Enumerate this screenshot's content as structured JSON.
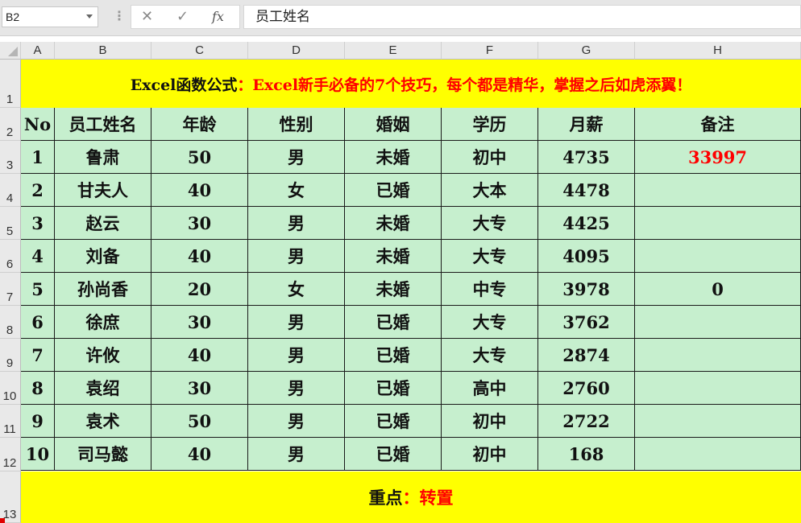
{
  "formula_bar": {
    "name_box": "B2",
    "formula": "员工姓名"
  },
  "columns": [
    "A",
    "B",
    "C",
    "D",
    "E",
    "F",
    "G",
    "H"
  ],
  "rows": [
    "1",
    "2",
    "3",
    "4",
    "5",
    "6",
    "7",
    "8",
    "9",
    "10",
    "11",
    "12",
    "13"
  ],
  "title": {
    "prefix": "Excel函数公式",
    "suffix": "：Excel新手必备的7个技巧，每个都是精华，掌握之后如虎添翼！"
  },
  "table": {
    "headers": [
      "No",
      "员工姓名",
      "年龄",
      "性别",
      "婚姻",
      "学历",
      "月薪",
      "备注"
    ],
    "rows": [
      [
        "1",
        "鲁肃",
        "50",
        "男",
        "未婚",
        "初中",
        "4735",
        "33997"
      ],
      [
        "2",
        "甘夫人",
        "40",
        "女",
        "已婚",
        "大本",
        "4478",
        ""
      ],
      [
        "3",
        "赵云",
        "30",
        "男",
        "未婚",
        "大专",
        "4425",
        ""
      ],
      [
        "4",
        "刘备",
        "40",
        "男",
        "未婚",
        "大专",
        "4095",
        ""
      ],
      [
        "5",
        "孙尚香",
        "20",
        "女",
        "未婚",
        "中专",
        "3978",
        "0"
      ],
      [
        "6",
        "徐庶",
        "30",
        "男",
        "已婚",
        "大专",
        "3762",
        ""
      ],
      [
        "7",
        "许攸",
        "40",
        "男",
        "已婚",
        "大专",
        "2874",
        ""
      ],
      [
        "8",
        "袁绍",
        "30",
        "男",
        "已婚",
        "高中",
        "2760",
        ""
      ],
      [
        "9",
        "袁术",
        "50",
        "男",
        "已婚",
        "初中",
        "2722",
        ""
      ],
      [
        "10",
        "司马懿",
        "40",
        "男",
        "已婚",
        "初中",
        "168",
        ""
      ]
    ]
  },
  "footer": {
    "prefix": "重点",
    "suffix": "：转置"
  },
  "colors": {
    "yellow": "#ffff00",
    "green": "#c6efce",
    "red": "#ff0000"
  }
}
